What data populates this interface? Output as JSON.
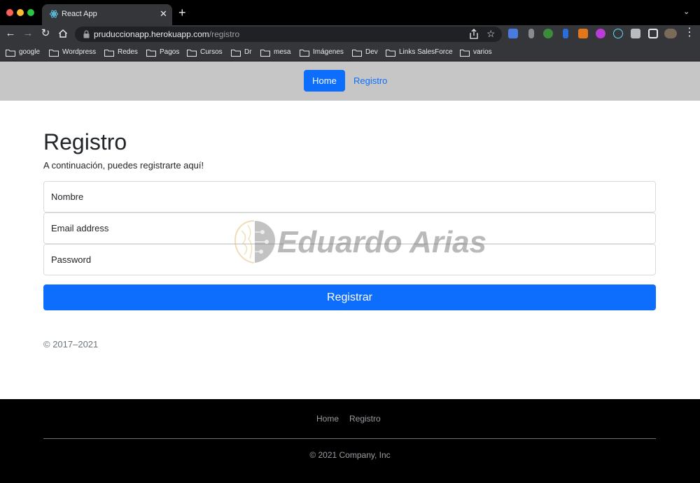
{
  "browser": {
    "tab_title": "React App",
    "tab_close": "✕",
    "new_tab": "+",
    "tab_menu": "⌄",
    "url_host": "pruduccionapp.herokuapp.com",
    "url_path": "/registro",
    "bookmarks": [
      "google",
      "Wordpress",
      "Redes",
      "Pagos",
      "Cursos",
      "Dr",
      "mesa",
      "Imágenes",
      "Dev",
      "Links SalesForce",
      "varios"
    ]
  },
  "nav": {
    "home": "Home",
    "registro": "Registro"
  },
  "page": {
    "title": "Registro",
    "subtitle": "A continuación, puedes registrarte aquí!",
    "name_placeholder": "Nombre",
    "email_placeholder": "Email address",
    "password_placeholder": "Password",
    "submit_label": "Registrar",
    "copyright": "© 2017–2021"
  },
  "watermark": {
    "text": "Eduardo Arias"
  },
  "footer": {
    "links": [
      "Home",
      "Registro"
    ],
    "copyright": "© 2021 Company, Inc"
  },
  "colors": {
    "primary": "#0d6efd",
    "header_bg": "#c6c6c6",
    "footer_bg": "#000000",
    "muted": "#6c757d"
  }
}
